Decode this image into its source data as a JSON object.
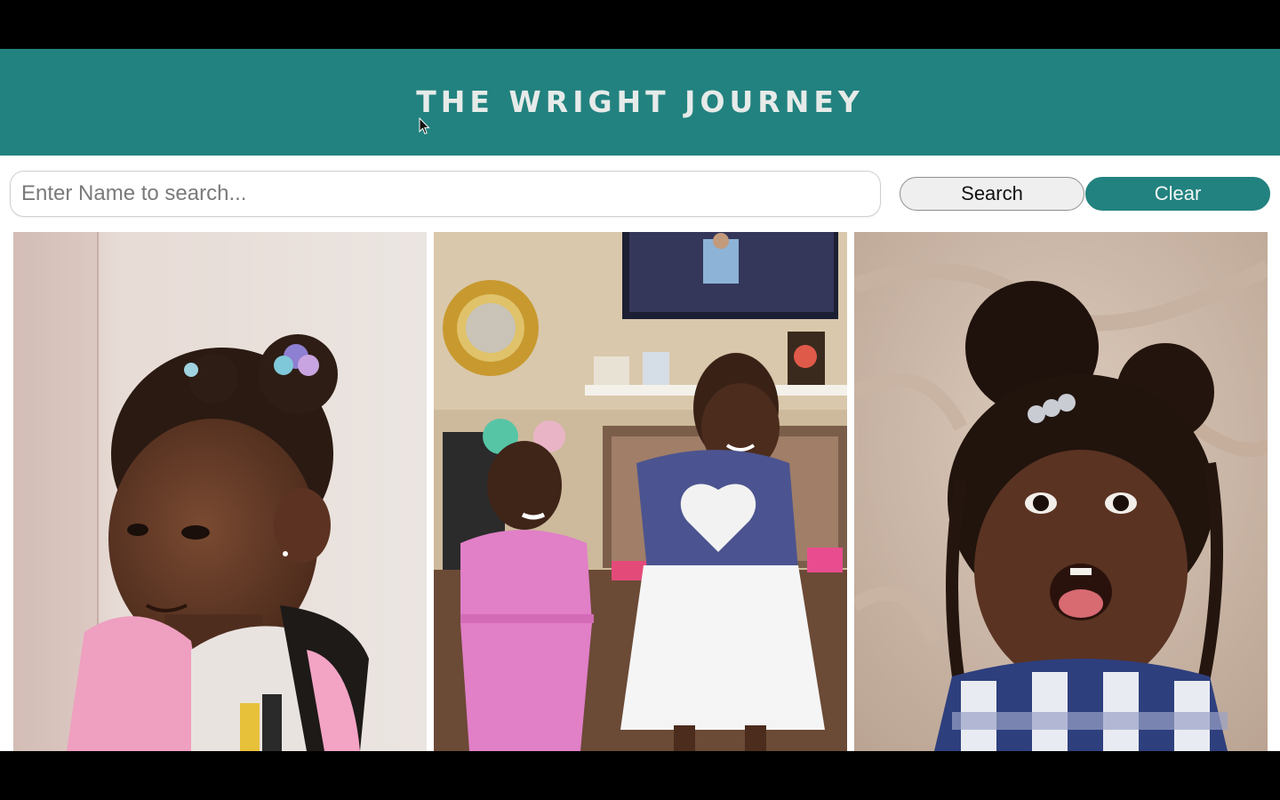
{
  "header": {
    "title": "THE WRIGHT JOURNEY"
  },
  "search": {
    "placeholder": "Enter Name to search...",
    "value": ""
  },
  "buttons": {
    "search_label": "Search",
    "clear_label": "Clear"
  },
  "colors": {
    "accent": "#22827f",
    "header_text": "#e6ebe9"
  },
  "gallery": {
    "photos": [
      {
        "subject": "girl-in-pink-jacket"
      },
      {
        "subject": "two-girls-in-living-room"
      },
      {
        "subject": "girl-on-blanket"
      }
    ]
  }
}
